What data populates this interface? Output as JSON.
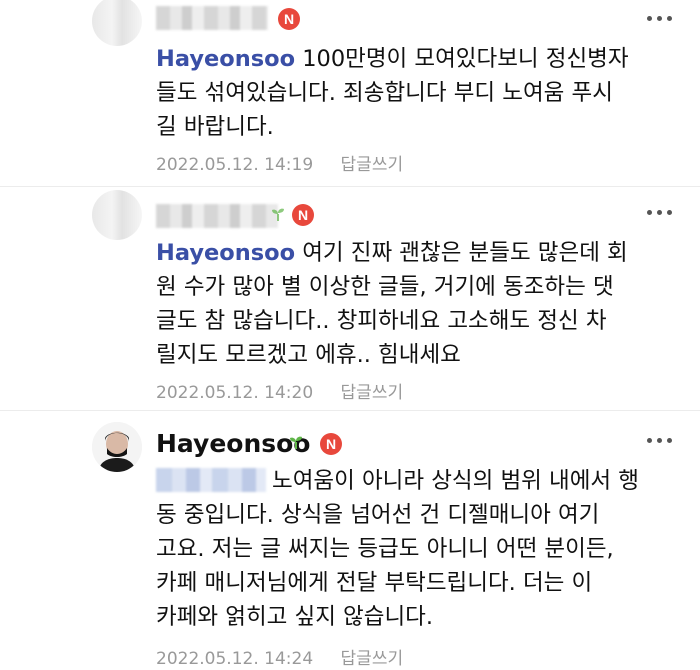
{
  "comments": [
    {
      "author": "",
      "mention": "Hayeonsoo",
      "text": " 100만명이 모여있다보니 정신병자\n들도 섞여있습니다. 죄송합니다 부디 노여움 푸시\n길 바랍니다.",
      "date": "2022.05.12. 14:19",
      "reply_label": "답글쓰기"
    },
    {
      "author": "",
      "mention": "Hayeonsoo",
      "text": " 여기 진짜 괜찮은 분들도 많은데 회\n원 수가 많아 별 이상한 글들, 거기에 동조하는 댓\n글도 참 많습니다.. 창피하네요 고소해도 정신 차\n릴지도 모르겠고 에휴.. 힘내세요",
      "date": "2022.05.12. 14:20",
      "reply_label": "답글쓰기"
    },
    {
      "author": "Hayeonsoo",
      "mention": "",
      "text": "노여움이 아니라 상식의 범위 내에서 행\n동 중입니다. 상식을 넘어선 건 디젤매니아 여기\n고요. 저는 글 써지는 등급도 아니니 어떤 분이든,\n카페 매니저님에게 전달 부탁드립니다. 더는 이\n카페와 얽히고 싶지 않습니다.",
      "date": "2022.05.12. 14:24",
      "reply_label": "답글쓰기"
    }
  ],
  "badge_label": "N",
  "colors": {
    "badge": "#e8483c",
    "mention": "#3a4fa6",
    "meta": "#999999",
    "sprout": "#5fb548"
  }
}
